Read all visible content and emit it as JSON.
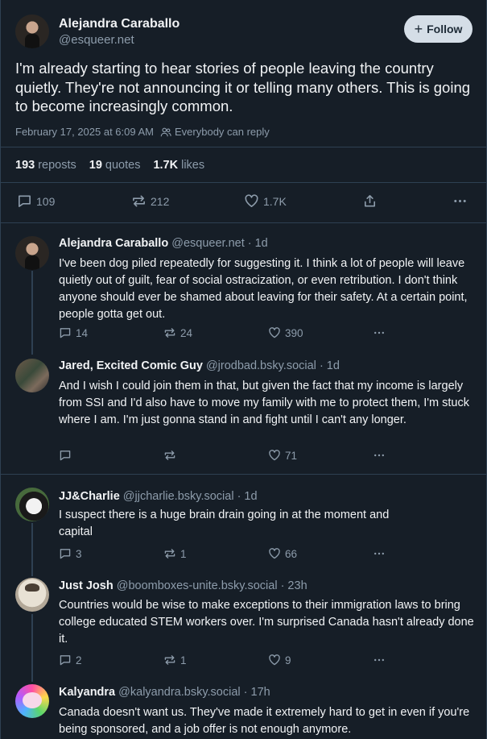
{
  "main_post": {
    "author_name": "Alejandra Caraballo",
    "author_handle": "@esqueer.net",
    "follow_label": "Follow",
    "text": "I'm already starting to hear stories of people leaving the country quietly. They're not announcing it or telling many others. This is going to become increasingly common.",
    "timestamp": "February 17, 2025 at 6:09 AM",
    "reply_setting": "Everybody can reply",
    "reposts_count": "193",
    "reposts_label": "reposts",
    "quotes_count": "19",
    "quotes_label": "quotes",
    "likes_count": "1.7K",
    "likes_label": "likes",
    "reply_count": "109",
    "repost_count": "212",
    "like_count": "1.7K"
  },
  "replies": [
    {
      "name": "Alejandra Caraballo",
      "handle": "@esqueer.net",
      "age": "· 1d",
      "text": "I've been dog piled repeatedly for suggesting it. I think a lot of people will leave quietly out of guilt, fear of social ostracization, or even retribution. I don't think anyone should ever be shamed about leaving for their safety. At a certain point, people gotta get out.",
      "replies": "14",
      "reposts": "24",
      "likes": "390"
    },
    {
      "name": "Jared, Excited Comic Guy",
      "handle": "@jrodbad.bsky.social",
      "age": "· 1d",
      "text": "And I wish I could join them in that, but given the fact that my income is largely from SSI and I'd also have to move my family with me to protect them, I'm stuck where I am. I'm just gonna stand in and fight until I can't any longer.",
      "replies": "",
      "reposts": "",
      "likes": "71"
    },
    {
      "name": "JJ&Charlie",
      "handle": "@jjcharlie.bsky.social",
      "age": "· 1d",
      "text": "I suspect there is a huge brain drain going in at the moment and capital",
      "replies": "3",
      "reposts": "1",
      "likes": "66"
    },
    {
      "name": "Just Josh",
      "handle": "@boomboxes-unite.bsky.social",
      "age": "· 23h",
      "text": "Countries would be wise to make exceptions to their immigration laws to bring college educated STEM workers over. I'm surprised Canada hasn't already done it.",
      "replies": "2",
      "reposts": "1",
      "likes": "9"
    },
    {
      "name": "Kalyandra",
      "handle": "@kalyandra.bsky.social",
      "age": "· 17h",
      "text": "Canada doesn't want us. They've made it extremely hard to get in even if you're being sponsored, and a job offer is not enough anymore.",
      "replies": "",
      "reposts": "",
      "likes": ""
    }
  ],
  "icons": [
    "reply-icon",
    "repost-icon",
    "heart-icon",
    "share-icon",
    "more-icon",
    "people-icon",
    "plus-icon"
  ],
  "colors": {
    "background": "#161e27",
    "border": "#2e4052",
    "muted": "#8d9cab",
    "text": "#f1f3f5",
    "follow_bg": "#d5dee7"
  }
}
